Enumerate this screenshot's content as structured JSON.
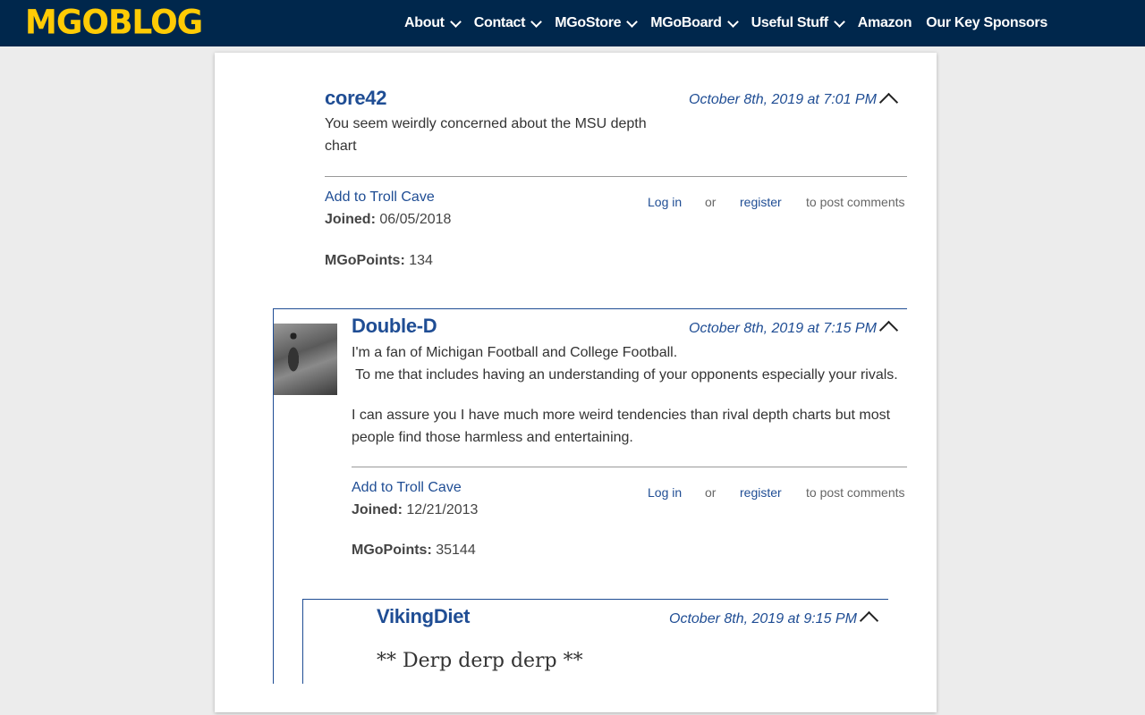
{
  "site": {
    "logo": "MGOBLOG",
    "nav": [
      {
        "label": "About",
        "has_dropdown": true
      },
      {
        "label": "Contact",
        "has_dropdown": true
      },
      {
        "label": "MGoStore",
        "has_dropdown": true
      },
      {
        "label": "MGoBoard",
        "has_dropdown": true
      },
      {
        "label": "Useful Stuff",
        "has_dropdown": true
      },
      {
        "label": "Amazon",
        "has_dropdown": false
      },
      {
        "label": "Our Key Sponsors",
        "has_dropdown": false
      }
    ]
  },
  "colors": {
    "nav_bg": "#00274c",
    "logo": "#ffcb05",
    "link": "#1f4d94"
  },
  "comments": [
    {
      "username": "core42",
      "date": "October 8th, 2019 at 7:01 PM",
      "body": [
        "You seem weirdly concerned about the MSU depth",
        "chart"
      ],
      "troll_cave": "Add to Troll Cave",
      "joined_label": "Joined:",
      "joined": "06/05/2018",
      "points_label": "MGoPoints:",
      "points": "134",
      "login": "Log in",
      "or": "or",
      "register": "register",
      "post_comments": "to post comments"
    },
    {
      "username": "Double-D",
      "date": "October 8th, 2019 at 7:15 PM",
      "body": [
        "I'm a fan of Michigan Football and College Football.",
        " To me that includes having an understanding of your opponents especially your rivals.",
        "I can assure you I have much more weird tendencies than rival depth charts but most",
        "people find those harmless and entertaining."
      ],
      "troll_cave": "Add to Troll Cave",
      "joined_label": "Joined:",
      "joined": "12/21/2013",
      "points_label": "MGoPoints:",
      "points": "35144",
      "login": "Log in",
      "or": "or",
      "register": "register",
      "post_comments": "to post comments"
    },
    {
      "username": "VikingDiet",
      "date": "October 8th, 2019 at 9:15 PM",
      "body": [
        "** Derp derp derp **"
      ]
    }
  ]
}
